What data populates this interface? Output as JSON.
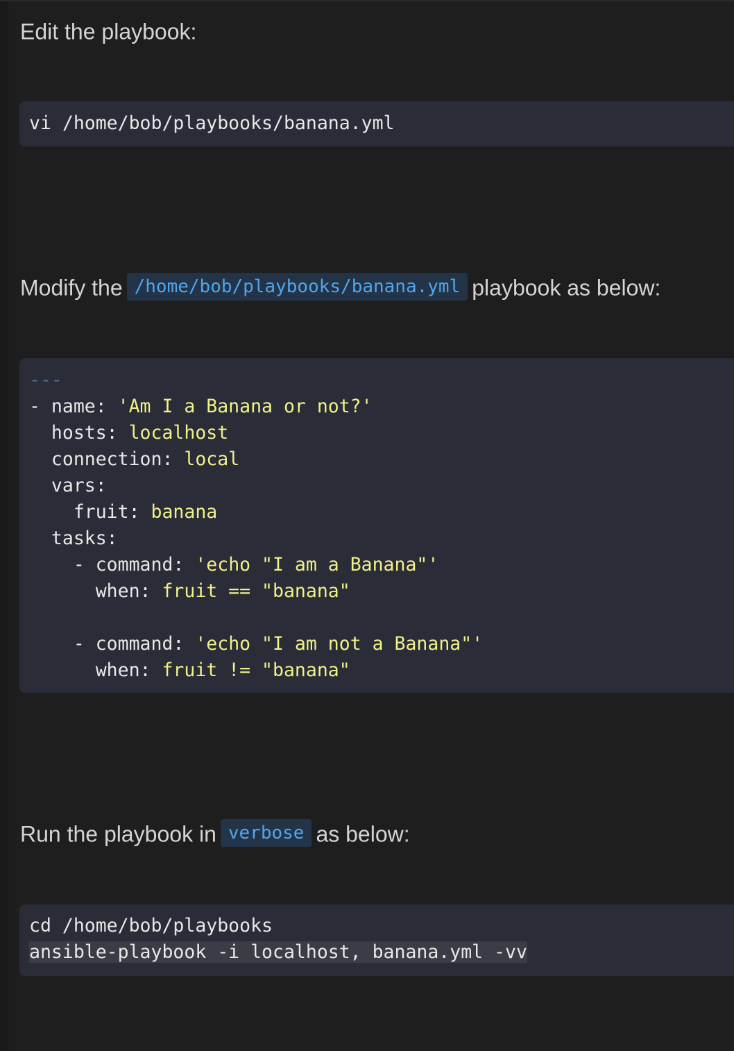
{
  "paragraphs": {
    "edit": "Edit the playbook:",
    "modify_before": "Modify the",
    "modify_code": "/home/bob/playbooks/banana.yml",
    "modify_after": "playbook as below:",
    "run_before": "Run the playbook in",
    "run_code": "verbose",
    "run_after": "as below:"
  },
  "code_blocks": {
    "edit_command": "vi /home/bob/playbooks/banana.yml",
    "playbook": {
      "doc_start": "---",
      "l1_key": "- name: ",
      "l1_val": "'Am I a Banana or not?'",
      "l2_key": "  hosts: ",
      "l2_val": "localhost",
      "l3_key": "  connection: ",
      "l3_val": "local",
      "l4_key": "  vars:",
      "l5_key": "    fruit: ",
      "l5_val": "banana",
      "l6_key": "  tasks:",
      "l7_key": "    - command: ",
      "l7_val": "'echo \"I am a Banana\"'",
      "l8_key": "      when: ",
      "l8_val": "fruit == \"banana\"",
      "l10_key": "    - command: ",
      "l10_val": "'echo \"I am not a Banana\"'",
      "l11_key": "      when: ",
      "l11_val": "fruit != \"banana\""
    },
    "run_commands": [
      "cd /home/bob/playbooks",
      "ansible-playbook -i localhost, banana.yml -vv"
    ]
  },
  "colors": {
    "background": "#1e1e1e",
    "code_background": "#2a2c37",
    "inline_code_text": "#4fa6ec",
    "inline_code_background": "#243448",
    "yaml_string": "#f1f18a",
    "yaml_doc_marker": "#5c6ea0"
  }
}
